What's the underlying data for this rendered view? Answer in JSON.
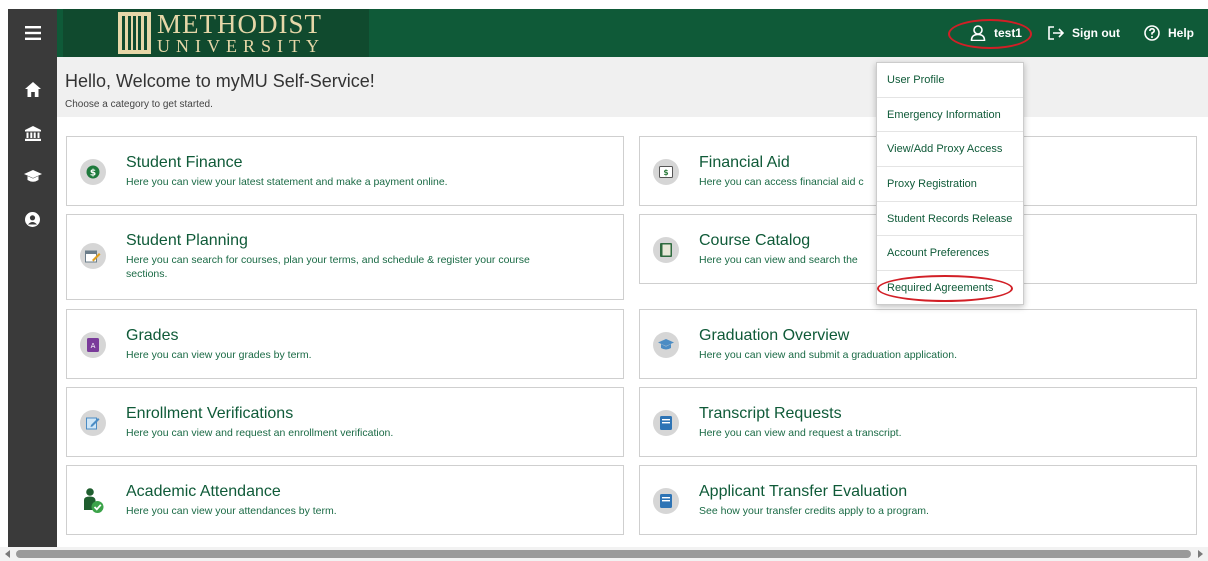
{
  "header": {
    "logo_line1": "METHODIST",
    "logo_line2": "UNIVERSITY",
    "username": "test1",
    "signout_label": "Sign out",
    "help_label": "Help"
  },
  "welcome": {
    "title": "Hello, Welcome to myMU Self-Service!",
    "subtitle": "Choose a category to get started."
  },
  "cards": [
    {
      "title": "Student Finance",
      "desc": "Here you can view your latest statement and make a payment online.",
      "icon": "dollar-icon"
    },
    {
      "title": "Financial Aid",
      "desc": "Here you can access financial aid c",
      "icon": "money-icon"
    },
    {
      "title": "Student Planning",
      "desc": "Here you can search for courses, plan your terms, and schedule & register your course sections.",
      "icon": "planner-icon"
    },
    {
      "title": "Course Catalog",
      "desc": "Here you can view and search the",
      "icon": "book-icon"
    },
    {
      "title": "Grades",
      "desc": "Here you can view your grades by term.",
      "icon": "grade-icon"
    },
    {
      "title": "Graduation Overview",
      "desc": "Here you can view and submit a graduation application.",
      "icon": "graduation-cap-icon"
    },
    {
      "title": "Enrollment Verifications",
      "desc": "Here you can view and request an enrollment verification.",
      "icon": "edit-check-icon"
    },
    {
      "title": "Transcript Requests",
      "desc": "Here you can view and request a transcript.",
      "icon": "document-icon"
    },
    {
      "title": "Academic Attendance",
      "desc": "Here you can view your attendances by term.",
      "icon": "person-check-icon"
    },
    {
      "title": "Applicant Transfer Evaluation",
      "desc": "See how your transfer credits apply to a program.",
      "icon": "document-icon"
    }
  ],
  "user_menu": {
    "items": [
      "User Profile",
      "Emergency Information",
      "View/Add Proxy Access",
      "Proxy Registration",
      "Student Records Release",
      "Account Preferences",
      "Required Agreements"
    ]
  },
  "colors": {
    "brand_green": "#0f5a38",
    "logo_gold": "#e6d7a8",
    "sidebar": "#3a3a3a",
    "highlight_red": "#d21f26"
  }
}
